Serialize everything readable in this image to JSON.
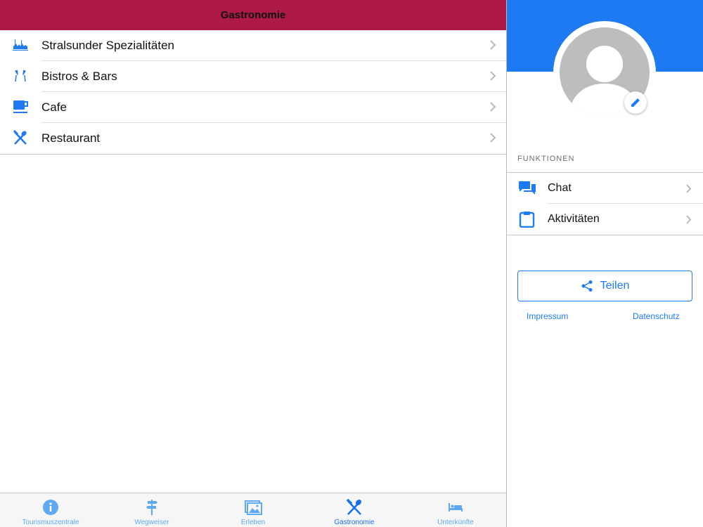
{
  "header": {
    "title": "Gastronomie"
  },
  "list": [
    {
      "label": "Stralsunder Spezialitäten",
      "icon": "harbor-city-icon"
    },
    {
      "label": "Bistros & Bars",
      "icon": "champagne-glasses-icon"
    },
    {
      "label": "Cafe",
      "icon": "coffee-cup-icon"
    },
    {
      "label": "Restaurant",
      "icon": "cutlery-icon"
    }
  ],
  "tabbar": {
    "tabs": [
      {
        "label": "Tourismuszentrale",
        "icon": "info-icon"
      },
      {
        "label": "Wegweiser",
        "icon": "signpost-icon"
      },
      {
        "label": "Erleben",
        "icon": "photos-icon"
      },
      {
        "label": "Gastronomie",
        "icon": "cutlery-icon",
        "active": true
      },
      {
        "label": "Unterkünfte",
        "icon": "bed-icon"
      }
    ]
  },
  "sidebar": {
    "section_header": "FUNKTIONEN",
    "items": [
      {
        "label": "Chat",
        "icon": "chat-icon"
      },
      {
        "label": "Aktivitäten",
        "icon": "clipboard-icon"
      }
    ],
    "share_label": "Teilen",
    "impressum": "Impressum",
    "datenschutz": "Datenschutz"
  },
  "colors": {
    "header": "#ac1a45",
    "accent": "#1e7af2",
    "tab_inactive": "#5fa9f0",
    "avatar_gray": "#bdbdbd"
  }
}
